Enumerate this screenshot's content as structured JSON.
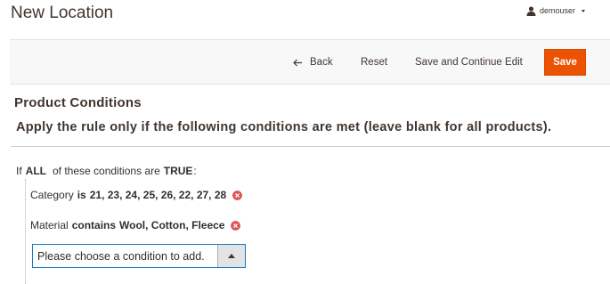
{
  "page": {
    "title": "New Location"
  },
  "user_menu": {
    "username": "demouser",
    "icons": [
      "user-icon",
      "caret-down-icon"
    ]
  },
  "toolbar": {
    "back_label": "Back",
    "reset_label": "Reset",
    "save_continue_label": "Save and Continue Edit",
    "save_label": "Save",
    "save_color": "#eb5202"
  },
  "section": {
    "title": "Product Conditions",
    "legend": "Apply the rule only if the following conditions are met (leave blank for all products)."
  },
  "rule": {
    "if_label": "If",
    "aggregator": "ALL",
    "mid_text": "of these conditions are",
    "value": "TRUE",
    "suffix": ":",
    "conditions": [
      {
        "attribute": "Category",
        "operator": "is",
        "value": "21, 23, 24, 25, 26, 22, 27, 28"
      },
      {
        "attribute": "Material",
        "operator": "contains",
        "value": "Wool, Cotton, Fleece"
      }
    ],
    "add_placeholder": "Please choose a condition to add."
  },
  "colors": {
    "accent": "#eb5202",
    "focus_border": "#1979c3",
    "remove_icon": "#e22626"
  }
}
